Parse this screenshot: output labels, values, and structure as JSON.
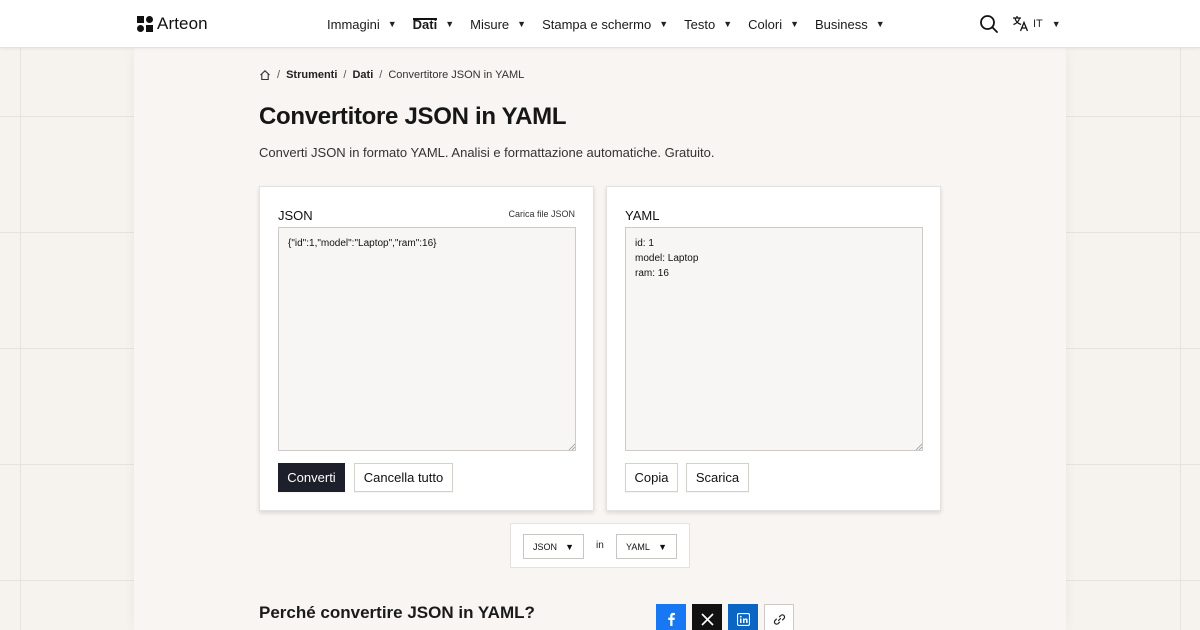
{
  "header": {
    "brand": "Arteon",
    "nav": [
      {
        "label": "Immagini",
        "active": false
      },
      {
        "label": "Dati",
        "active": true
      },
      {
        "label": "Misure",
        "active": false
      },
      {
        "label": "Stampa e schermo",
        "active": false
      },
      {
        "label": "Testo",
        "active": false
      },
      {
        "label": "Colori",
        "active": false
      },
      {
        "label": "Business",
        "active": false
      }
    ],
    "caret": "▼",
    "language": "IT"
  },
  "breadcrumb": {
    "items": [
      "Strumenti",
      "Dati"
    ],
    "current": "Convertitore JSON in YAML",
    "separator": "/"
  },
  "page": {
    "title": "Convertitore JSON in YAML",
    "description": "Converti JSON in formato YAML. Analisi e formattazione automatiche. Gratuito."
  },
  "input_card": {
    "label": "JSON",
    "upload_label": "Carica file JSON",
    "value": "{\"id\":1,\"model\":\"Laptop\",\"ram\":16}",
    "convert_label": "Converti",
    "clear_label": "Cancella tutto"
  },
  "output_card": {
    "label": "YAML",
    "value": "id: 1\nmodel: Laptop\nram: 16",
    "copy_label": "Copia",
    "download_label": "Scarica"
  },
  "format_bar": {
    "from": "JSON",
    "connector": "in",
    "to": "YAML"
  },
  "why_section": {
    "title": "Perché convertire JSON in YAML?"
  },
  "colors": {
    "primary_button": "#1d1f2b",
    "facebook": "#1877f2",
    "x": "#111111",
    "linkedin": "#0a66c2"
  }
}
